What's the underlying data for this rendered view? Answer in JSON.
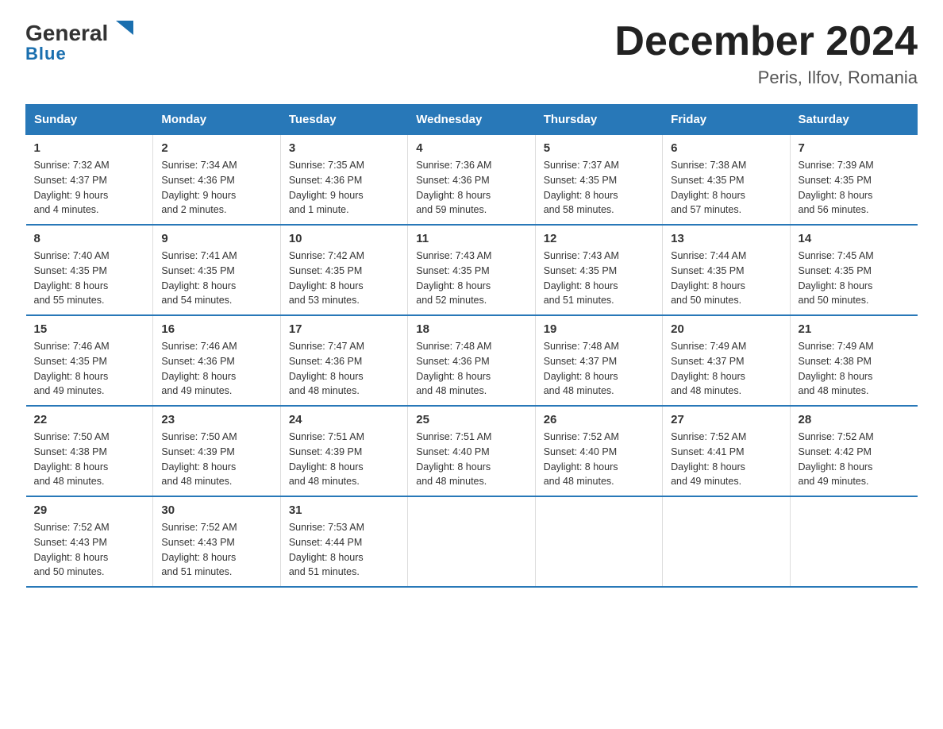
{
  "header": {
    "logo_general": "General",
    "logo_blue": "Blue",
    "main_title": "December 2024",
    "subtitle": "Peris, Ilfov, Romania"
  },
  "weekdays": [
    "Sunday",
    "Monday",
    "Tuesday",
    "Wednesday",
    "Thursday",
    "Friday",
    "Saturday"
  ],
  "weeks": [
    [
      {
        "day": "1",
        "info": "Sunrise: 7:32 AM\nSunset: 4:37 PM\nDaylight: 9 hours\nand 4 minutes."
      },
      {
        "day": "2",
        "info": "Sunrise: 7:34 AM\nSunset: 4:36 PM\nDaylight: 9 hours\nand 2 minutes."
      },
      {
        "day": "3",
        "info": "Sunrise: 7:35 AM\nSunset: 4:36 PM\nDaylight: 9 hours\nand 1 minute."
      },
      {
        "day": "4",
        "info": "Sunrise: 7:36 AM\nSunset: 4:36 PM\nDaylight: 8 hours\nand 59 minutes."
      },
      {
        "day": "5",
        "info": "Sunrise: 7:37 AM\nSunset: 4:35 PM\nDaylight: 8 hours\nand 58 minutes."
      },
      {
        "day": "6",
        "info": "Sunrise: 7:38 AM\nSunset: 4:35 PM\nDaylight: 8 hours\nand 57 minutes."
      },
      {
        "day": "7",
        "info": "Sunrise: 7:39 AM\nSunset: 4:35 PM\nDaylight: 8 hours\nand 56 minutes."
      }
    ],
    [
      {
        "day": "8",
        "info": "Sunrise: 7:40 AM\nSunset: 4:35 PM\nDaylight: 8 hours\nand 55 minutes."
      },
      {
        "day": "9",
        "info": "Sunrise: 7:41 AM\nSunset: 4:35 PM\nDaylight: 8 hours\nand 54 minutes."
      },
      {
        "day": "10",
        "info": "Sunrise: 7:42 AM\nSunset: 4:35 PM\nDaylight: 8 hours\nand 53 minutes."
      },
      {
        "day": "11",
        "info": "Sunrise: 7:43 AM\nSunset: 4:35 PM\nDaylight: 8 hours\nand 52 minutes."
      },
      {
        "day": "12",
        "info": "Sunrise: 7:43 AM\nSunset: 4:35 PM\nDaylight: 8 hours\nand 51 minutes."
      },
      {
        "day": "13",
        "info": "Sunrise: 7:44 AM\nSunset: 4:35 PM\nDaylight: 8 hours\nand 50 minutes."
      },
      {
        "day": "14",
        "info": "Sunrise: 7:45 AM\nSunset: 4:35 PM\nDaylight: 8 hours\nand 50 minutes."
      }
    ],
    [
      {
        "day": "15",
        "info": "Sunrise: 7:46 AM\nSunset: 4:35 PM\nDaylight: 8 hours\nand 49 minutes."
      },
      {
        "day": "16",
        "info": "Sunrise: 7:46 AM\nSunset: 4:36 PM\nDaylight: 8 hours\nand 49 minutes."
      },
      {
        "day": "17",
        "info": "Sunrise: 7:47 AM\nSunset: 4:36 PM\nDaylight: 8 hours\nand 48 minutes."
      },
      {
        "day": "18",
        "info": "Sunrise: 7:48 AM\nSunset: 4:36 PM\nDaylight: 8 hours\nand 48 minutes."
      },
      {
        "day": "19",
        "info": "Sunrise: 7:48 AM\nSunset: 4:37 PM\nDaylight: 8 hours\nand 48 minutes."
      },
      {
        "day": "20",
        "info": "Sunrise: 7:49 AM\nSunset: 4:37 PM\nDaylight: 8 hours\nand 48 minutes."
      },
      {
        "day": "21",
        "info": "Sunrise: 7:49 AM\nSunset: 4:38 PM\nDaylight: 8 hours\nand 48 minutes."
      }
    ],
    [
      {
        "day": "22",
        "info": "Sunrise: 7:50 AM\nSunset: 4:38 PM\nDaylight: 8 hours\nand 48 minutes."
      },
      {
        "day": "23",
        "info": "Sunrise: 7:50 AM\nSunset: 4:39 PM\nDaylight: 8 hours\nand 48 minutes."
      },
      {
        "day": "24",
        "info": "Sunrise: 7:51 AM\nSunset: 4:39 PM\nDaylight: 8 hours\nand 48 minutes."
      },
      {
        "day": "25",
        "info": "Sunrise: 7:51 AM\nSunset: 4:40 PM\nDaylight: 8 hours\nand 48 minutes."
      },
      {
        "day": "26",
        "info": "Sunrise: 7:52 AM\nSunset: 4:40 PM\nDaylight: 8 hours\nand 48 minutes."
      },
      {
        "day": "27",
        "info": "Sunrise: 7:52 AM\nSunset: 4:41 PM\nDaylight: 8 hours\nand 49 minutes."
      },
      {
        "day": "28",
        "info": "Sunrise: 7:52 AM\nSunset: 4:42 PM\nDaylight: 8 hours\nand 49 minutes."
      }
    ],
    [
      {
        "day": "29",
        "info": "Sunrise: 7:52 AM\nSunset: 4:43 PM\nDaylight: 8 hours\nand 50 minutes."
      },
      {
        "day": "30",
        "info": "Sunrise: 7:52 AM\nSunset: 4:43 PM\nDaylight: 8 hours\nand 51 minutes."
      },
      {
        "day": "31",
        "info": "Sunrise: 7:53 AM\nSunset: 4:44 PM\nDaylight: 8 hours\nand 51 minutes."
      },
      {
        "day": "",
        "info": ""
      },
      {
        "day": "",
        "info": ""
      },
      {
        "day": "",
        "info": ""
      },
      {
        "day": "",
        "info": ""
      }
    ]
  ]
}
